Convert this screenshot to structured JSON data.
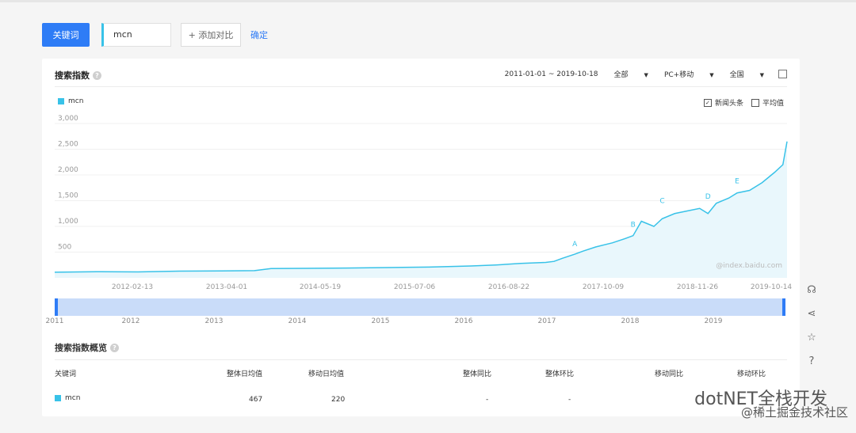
{
  "toolbar": {
    "keyword_button": "关键词",
    "keyword_value": "mcn",
    "add_compare": "+ 添加对比",
    "confirm": "确定"
  },
  "index_card": {
    "title": "搜索指数",
    "date_range": "2011-01-01 ~ 2019-10-18",
    "scope": "全部",
    "device": "PC+移动",
    "region": "全国",
    "legend": "mcn",
    "check_news": "新闻头条",
    "check_avg": "平均值",
    "watermark": "@index.baidu.com"
  },
  "chart_data": {
    "type": "area",
    "series": [
      {
        "name": "mcn",
        "color": "#38c2e8"
      }
    ],
    "y_ticks": [
      "3,000",
      "2,500",
      "2,000",
      "1,500",
      "1,000",
      "500"
    ],
    "x_ticks": [
      "2012-02-13",
      "2013-04-01",
      "2014-05-19",
      "2015-07-06",
      "2016-08-22",
      "2017-10-09",
      "2018-11-26",
      "2019-10-14"
    ],
    "ylim": [
      0,
      3000
    ],
    "annotations": [
      "A",
      "B",
      "C",
      "D",
      "E"
    ],
    "years": [
      "2011",
      "2012",
      "2013",
      "2014",
      "2015",
      "2016",
      "2017",
      "2018",
      "2019"
    ],
    "x": [
      2011.0,
      2011.5,
      2012.0,
      2012.5,
      2013.0,
      2013.4,
      2013.6,
      2014.0,
      2014.5,
      2015.0,
      2015.5,
      2016.0,
      2016.3,
      2016.6,
      2016.9,
      2017.0,
      2017.1,
      2017.25,
      2017.35,
      2017.5,
      2017.7,
      2017.85,
      2017.95,
      2018.05,
      2018.2,
      2018.3,
      2018.45,
      2018.6,
      2018.75,
      2018.85,
      2018.95,
      2019.1,
      2019.2,
      2019.35,
      2019.5,
      2019.65,
      2019.75,
      2019.8
    ],
    "values": [
      110,
      120,
      115,
      130,
      135,
      140,
      180,
      185,
      190,
      200,
      210,
      230,
      250,
      280,
      300,
      320,
      380,
      460,
      520,
      600,
      680,
      760,
      820,
      1100,
      1000,
      1150,
      1250,
      1300,
      1350,
      1250,
      1450,
      1550,
      1650,
      1700,
      1850,
      2050,
      2200,
      2650
    ]
  },
  "summary": {
    "title": "搜索指数概览",
    "headers": [
      "关键词",
      "整体日均值",
      "移动日均值",
      "整体同比",
      "整体环比",
      "移动同比",
      "移动环比"
    ],
    "row": {
      "keyword": "mcn",
      "overall_avg": "467",
      "mobile_avg": "220",
      "overall_yoy": "-",
      "overall_mom": "-"
    }
  },
  "watermark": {
    "line1": "dotNET全栈开发",
    "line2": "@稀土掘金技术社区"
  }
}
